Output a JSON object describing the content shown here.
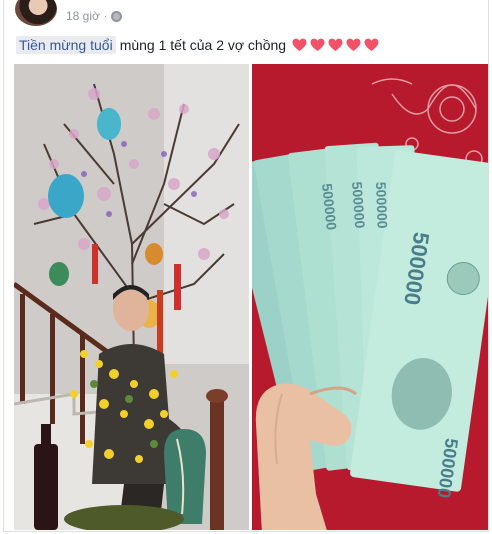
{
  "post": {
    "timestamp": "18 giờ",
    "dot": "·",
    "tag_text": "Tiền mừng tuổi",
    "caption_rest": " mùng 1 tết của 2 vợ chồng",
    "heart_count": 5,
    "heart_color": "#f25268"
  },
  "photos": {
    "left": {
      "kind": "tree-and-man"
    },
    "right": {
      "kind": "banknotes"
    }
  }
}
